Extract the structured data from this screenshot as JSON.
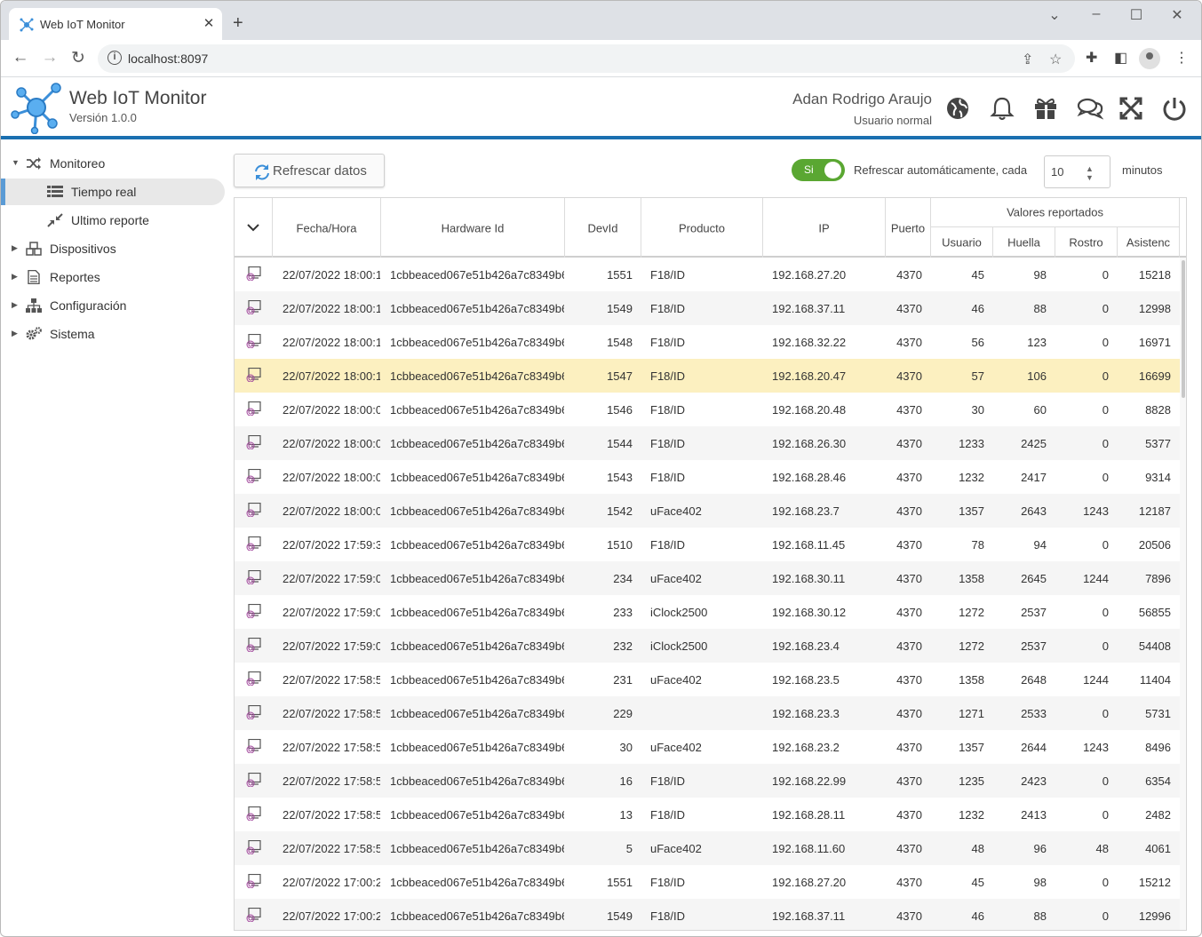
{
  "browser": {
    "tab_title": "Web IoT Monitor",
    "tab_close": "✕",
    "new_tab": "+",
    "url": "localhost:8097"
  },
  "app": {
    "title": "Web IoT Monitor",
    "version": "Versión 1.0.0",
    "user_name": "Adan Rodrigo Araujo",
    "user_role": "Usuario normal",
    "header_icons": [
      "globe-icon",
      "bell-icon",
      "gift-icon",
      "chat-icon",
      "fullscreen-icon",
      "power-icon"
    ]
  },
  "sidebar": {
    "items": [
      {
        "label": "Monitoreo",
        "icon": "shuffle-icon",
        "expanded": true
      },
      {
        "label": "Tiempo real",
        "icon": "list-icon",
        "active": true
      },
      {
        "label": "Ultimo reporte",
        "icon": "compress-icon"
      },
      {
        "label": "Dispositivos",
        "icon": "cubes-icon"
      },
      {
        "label": "Reportes",
        "icon": "document-icon"
      },
      {
        "label": "Configuración",
        "icon": "sitemap-icon"
      },
      {
        "label": "Sistema",
        "icon": "cogs-icon"
      }
    ]
  },
  "controls": {
    "refresh_label": "Refrescar datos",
    "toggle_label": "Si",
    "auto_label": "Refrescar automáticamente, cada",
    "interval_value": "10",
    "minutes_label": "minutos"
  },
  "table": {
    "headers": {
      "fecha": "Fecha/Hora",
      "hardware": "Hardware Id",
      "devid": "DevId",
      "producto": "Producto",
      "ip": "IP",
      "puerto": "Puerto",
      "valores": "Valores reportados",
      "usuario": "Usuario",
      "huella": "Huella",
      "rostro": "Rostro",
      "asistencia": "Asistenc"
    },
    "rows": [
      {
        "fecha": "22/07/2022 18:00:1",
        "hw": "1cbbeaced067e51b426a7c8349b6",
        "devid": "1551",
        "producto": "F18/ID",
        "ip": "192.168.27.20",
        "puerto": "4370",
        "usuario": "45",
        "huella": "98",
        "rostro": "0",
        "asist": "15218"
      },
      {
        "fecha": "22/07/2022 18:00:1",
        "hw": "1cbbeaced067e51b426a7c8349b6",
        "devid": "1549",
        "producto": "F18/ID",
        "ip": "192.168.37.11",
        "puerto": "4370",
        "usuario": "46",
        "huella": "88",
        "rostro": "0",
        "asist": "12998"
      },
      {
        "fecha": "22/07/2022 18:00:1",
        "hw": "1cbbeaced067e51b426a7c8349b6",
        "devid": "1548",
        "producto": "F18/ID",
        "ip": "192.168.32.22",
        "puerto": "4370",
        "usuario": "56",
        "huella": "123",
        "rostro": "0",
        "asist": "16971"
      },
      {
        "fecha": "22/07/2022 18:00:1",
        "hw": "1cbbeaced067e51b426a7c8349b6",
        "devid": "1547",
        "producto": "F18/ID",
        "ip": "192.168.20.47",
        "puerto": "4370",
        "usuario": "57",
        "huella": "106",
        "rostro": "0",
        "asist": "16699",
        "selected": true
      },
      {
        "fecha": "22/07/2022 18:00:0",
        "hw": "1cbbeaced067e51b426a7c8349b6",
        "devid": "1546",
        "producto": "F18/ID",
        "ip": "192.168.20.48",
        "puerto": "4370",
        "usuario": "30",
        "huella": "60",
        "rostro": "0",
        "asist": "8828"
      },
      {
        "fecha": "22/07/2022 18:00:0",
        "hw": "1cbbeaced067e51b426a7c8349b6",
        "devid": "1544",
        "producto": "F18/ID",
        "ip": "192.168.26.30",
        "puerto": "4370",
        "usuario": "1233",
        "huella": "2425",
        "rostro": "0",
        "asist": "5377"
      },
      {
        "fecha": "22/07/2022 18:00:0",
        "hw": "1cbbeaced067e51b426a7c8349b6",
        "devid": "1543",
        "producto": "F18/ID",
        "ip": "192.168.28.46",
        "puerto": "4370",
        "usuario": "1232",
        "huella": "2417",
        "rostro": "0",
        "asist": "9314"
      },
      {
        "fecha": "22/07/2022 18:00:0",
        "hw": "1cbbeaced067e51b426a7c8349b6",
        "devid": "1542",
        "producto": "uFace402",
        "ip": "192.168.23.7",
        "puerto": "4370",
        "usuario": "1357",
        "huella": "2643",
        "rostro": "1243",
        "asist": "12187"
      },
      {
        "fecha": "22/07/2022 17:59:3",
        "hw": "1cbbeaced067e51b426a7c8349b6",
        "devid": "1510",
        "producto": "F18/ID",
        "ip": "192.168.11.45",
        "puerto": "4370",
        "usuario": "78",
        "huella": "94",
        "rostro": "0",
        "asist": "20506"
      },
      {
        "fecha": "22/07/2022 17:59:0",
        "hw": "1cbbeaced067e51b426a7c8349b6",
        "devid": "234",
        "producto": "uFace402",
        "ip": "192.168.30.11",
        "puerto": "4370",
        "usuario": "1358",
        "huella": "2645",
        "rostro": "1244",
        "asist": "7896"
      },
      {
        "fecha": "22/07/2022 17:59:0",
        "hw": "1cbbeaced067e51b426a7c8349b6",
        "devid": "233",
        "producto": "iClock2500",
        "ip": "192.168.30.12",
        "puerto": "4370",
        "usuario": "1272",
        "huella": "2537",
        "rostro": "0",
        "asist": "56855"
      },
      {
        "fecha": "22/07/2022 17:59:0",
        "hw": "1cbbeaced067e51b426a7c8349b6",
        "devid": "232",
        "producto": "iClock2500",
        "ip": "192.168.23.4",
        "puerto": "4370",
        "usuario": "1272",
        "huella": "2537",
        "rostro": "0",
        "asist": "54408"
      },
      {
        "fecha": "22/07/2022 17:58:5",
        "hw": "1cbbeaced067e51b426a7c8349b6",
        "devid": "231",
        "producto": "uFace402",
        "ip": "192.168.23.5",
        "puerto": "4370",
        "usuario": "1358",
        "huella": "2648",
        "rostro": "1244",
        "asist": "11404"
      },
      {
        "fecha": "22/07/2022 17:58:5",
        "hw": "1cbbeaced067e51b426a7c8349b6",
        "devid": "229",
        "producto": "",
        "ip": "192.168.23.3",
        "puerto": "4370",
        "usuario": "1271",
        "huella": "2533",
        "rostro": "0",
        "asist": "5731"
      },
      {
        "fecha": "22/07/2022 17:58:5",
        "hw": "1cbbeaced067e51b426a7c8349b6",
        "devid": "30",
        "producto": "uFace402",
        "ip": "192.168.23.2",
        "puerto": "4370",
        "usuario": "1357",
        "huella": "2644",
        "rostro": "1243",
        "asist": "8496"
      },
      {
        "fecha": "22/07/2022 17:58:5",
        "hw": "1cbbeaced067e51b426a7c8349b6",
        "devid": "16",
        "producto": "F18/ID",
        "ip": "192.168.22.99",
        "puerto": "4370",
        "usuario": "1235",
        "huella": "2423",
        "rostro": "0",
        "asist": "6354"
      },
      {
        "fecha": "22/07/2022 17:58:5",
        "hw": "1cbbeaced067e51b426a7c8349b6",
        "devid": "13",
        "producto": "F18/ID",
        "ip": "192.168.28.11",
        "puerto": "4370",
        "usuario": "1232",
        "huella": "2413",
        "rostro": "0",
        "asist": "2482"
      },
      {
        "fecha": "22/07/2022 17:58:5",
        "hw": "1cbbeaced067e51b426a7c8349b6",
        "devid": "5",
        "producto": "uFace402",
        "ip": "192.168.11.60",
        "puerto": "4370",
        "usuario": "48",
        "huella": "96",
        "rostro": "48",
        "asist": "4061"
      },
      {
        "fecha": "22/07/2022 17:00:2",
        "hw": "1cbbeaced067e51b426a7c8349b6",
        "devid": "1551",
        "producto": "F18/ID",
        "ip": "192.168.27.20",
        "puerto": "4370",
        "usuario": "45",
        "huella": "98",
        "rostro": "0",
        "asist": "15212"
      },
      {
        "fecha": "22/07/2022 17:00:2",
        "hw": "1cbbeaced067e51b426a7c8349b6",
        "devid": "1549",
        "producto": "F18/ID",
        "ip": "192.168.37.11",
        "puerto": "4370",
        "usuario": "46",
        "huella": "88",
        "rostro": "0",
        "asist": "12996"
      }
    ]
  },
  "colors": {
    "accent": "#1a6fb0",
    "toggle_on": "#5aa732",
    "selected_row": "#fcf0c0"
  }
}
